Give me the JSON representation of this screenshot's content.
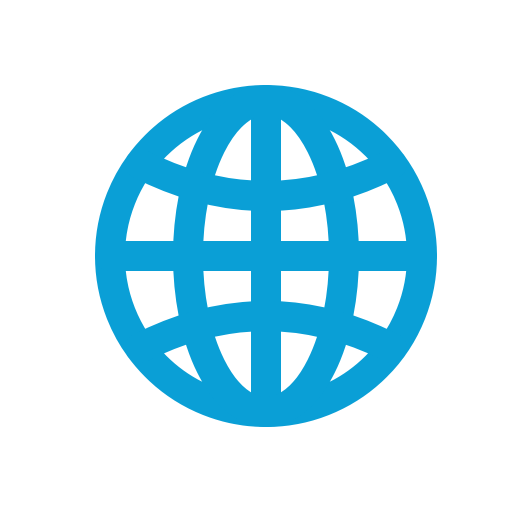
{
  "icon": {
    "name": "globe-icon",
    "color": "#0a9fd6",
    "background": "#ffffff"
  }
}
